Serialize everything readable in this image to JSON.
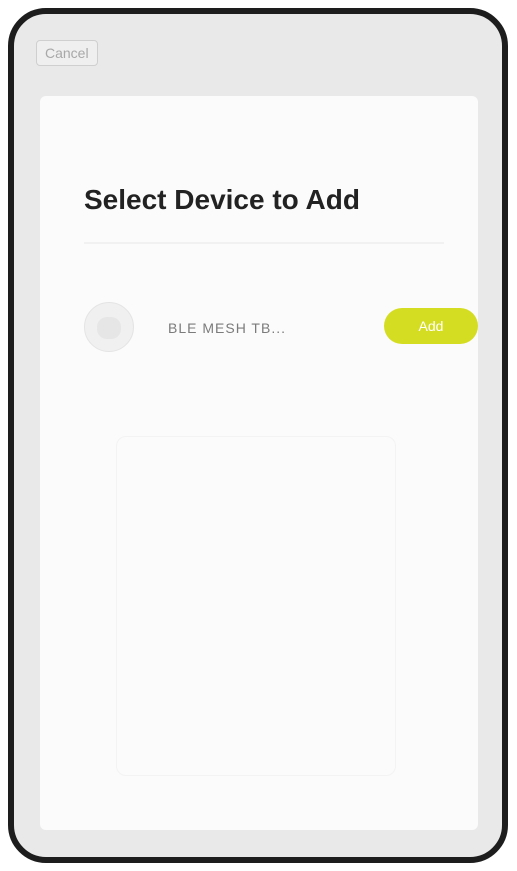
{
  "header": {
    "cancel_label": "Cancel"
  },
  "sheet": {
    "title": "Select Device to Add"
  },
  "devices": [
    {
      "name": "BLE MESH TB...",
      "add_label": "Add"
    }
  ],
  "colors": {
    "accent": "#d5dd22",
    "frame": "#1d1d1d",
    "background": "#e9e9e9",
    "sheet": "#fbfbfb"
  },
  "icons": {
    "device": "device-icon"
  }
}
